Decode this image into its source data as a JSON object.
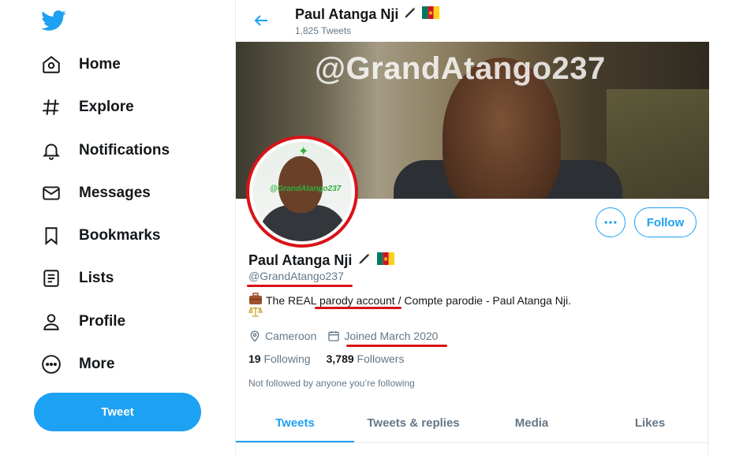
{
  "sidebar": {
    "logo_icon": "twitter-bird-icon",
    "items": [
      {
        "label": "Home",
        "icon": "home-icon"
      },
      {
        "label": "Explore",
        "icon": "hashtag-icon"
      },
      {
        "label": "Notifications",
        "icon": "bell-icon"
      },
      {
        "label": "Messages",
        "icon": "envelope-icon"
      },
      {
        "label": "Bookmarks",
        "icon": "bookmark-icon"
      },
      {
        "label": "Lists",
        "icon": "list-icon"
      },
      {
        "label": "Profile",
        "icon": "person-icon"
      },
      {
        "label": "More",
        "icon": "more-circle-icon"
      }
    ],
    "tweet_button": "Tweet"
  },
  "header": {
    "name": "Paul Atanga Nji",
    "tweet_count": "1,825 Tweets"
  },
  "banner": {
    "handle_text": "@GrandAtango237"
  },
  "avatar": {
    "tag": "@GrandAtango237"
  },
  "profile": {
    "name": "Paul Atanga Nji",
    "handle": "@GrandAtango237",
    "bio": "The REAL parody account / Compte parodie - Paul Atanga Nji.",
    "location": "Cameroon",
    "joined": "Joined March 2020",
    "following_count": "19",
    "following_label": "Following",
    "followers_count": "3,789",
    "followers_label": "Followers",
    "not_followed": "Not followed by anyone you’re following",
    "follow_button": "Follow"
  },
  "tabs": [
    {
      "label": "Tweets",
      "active": true
    },
    {
      "label": "Tweets & replies",
      "active": false
    },
    {
      "label": "Media",
      "active": false
    },
    {
      "label": "Likes",
      "active": false
    }
  ],
  "colors": {
    "accent": "#1da1f2",
    "annotation_red": "#d81318",
    "secondary_text": "#657786"
  }
}
